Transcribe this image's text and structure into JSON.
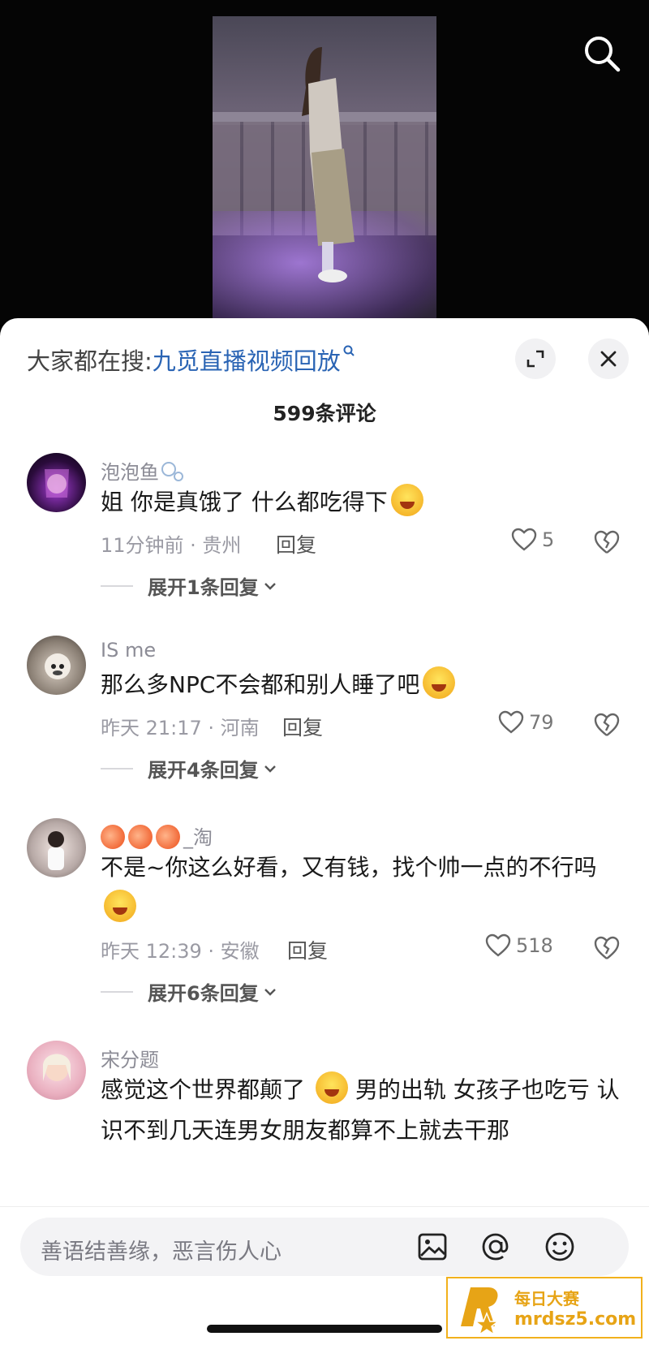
{
  "colors": {
    "accent_link": "#2a64b4",
    "watermark": "#e7a416"
  },
  "header": {
    "hot_search_prefix": "大家都在搜:",
    "hot_search_term": "九觅直播视频回放",
    "comment_count": "599条评论"
  },
  "icons": {
    "top_search": "search-icon",
    "expand": "expand-icon",
    "close": "close-icon",
    "image": "image-icon",
    "mention": "at-icon",
    "emoji": "emoji-icon"
  },
  "comments": [
    {
      "username": "泡泡鱼",
      "text": "姐 你是真饿了 什么都吃得下",
      "meta": "11分钟前 · 贵州",
      "reply": "回复",
      "likes": "5",
      "expand": "展开1条回复"
    },
    {
      "username": "IS me",
      "text": "那么多NPC不会都和别人睡了吧",
      "meta": "昨天 21:17 · 河南",
      "reply": "回复",
      "likes": "79",
      "expand": "展开4条回复"
    },
    {
      "username": "_淘",
      "text": "不是~你这么好看，又有钱，找个帅一点的不行吗",
      "meta": "昨天 12:39 · 安徽",
      "reply": "回复",
      "likes": "518",
      "expand": "展开6条回复"
    },
    {
      "username": "宋分题",
      "text_part1": "感觉这个世界都颠了",
      "text_part2": "男的出轨 女孩子也吃亏 认识不到几天连男女朋友都算不上就去干那"
    }
  ],
  "input": {
    "placeholder": "善语结善缘，恶言伤人心"
  },
  "watermark": {
    "line1": "每日大赛",
    "line2": "mrdsz5.com"
  }
}
